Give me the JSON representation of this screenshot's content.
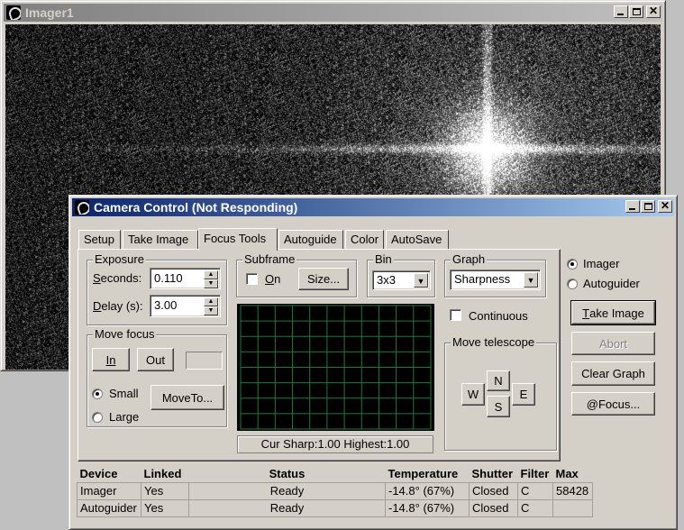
{
  "imager_window": {
    "title": "Imager1"
  },
  "camera_window": {
    "title": "Camera Control (Not Responding)"
  },
  "title_buttons": {
    "minimize_icon": "minimize-icon",
    "maximize_icon": "maximize-icon",
    "close_glyph": "✕"
  },
  "tabs": [
    {
      "label": "Setup",
      "selected": false
    },
    {
      "label": "Take Image",
      "selected": false
    },
    {
      "label": "Focus Tools",
      "selected": true
    },
    {
      "label": "Autoguide",
      "selected": false
    },
    {
      "label": "Color",
      "selected": false
    },
    {
      "label": "AutoSave",
      "selected": false
    }
  ],
  "exposure": {
    "legend": "Exposure",
    "seconds_label_u": "S",
    "seconds_label_rest": "econds:",
    "seconds_value": "0.110",
    "delay_label_u": "D",
    "delay_label_rest": "elay (s):",
    "delay_value": "3.00"
  },
  "subframe": {
    "legend": "Subframe",
    "on_label_u": "O",
    "on_label_rest": "n",
    "on_checked": false,
    "size_label": "Size..."
  },
  "bin": {
    "legend": "Bin",
    "selected": "3x3"
  },
  "graph": {
    "legend": "Graph",
    "selected": "Sharpness"
  },
  "camera_select": {
    "imager_label": "Imager",
    "autoguider_label": "Autoguider",
    "selected": "Imager"
  },
  "continuous": {
    "label": "Continuous",
    "checked": false
  },
  "buttons": {
    "take_image_u": "T",
    "take_image_rest": "ake Image",
    "abort": "Abort",
    "clear_graph": "Clear Graph",
    "at_focus": "@Focus..."
  },
  "move_focus": {
    "legend": "Move focus",
    "in": "In",
    "out": "Out",
    "small_label": "Small",
    "large_label": "Large",
    "selected": "Small",
    "move_to": "MoveTo...",
    "position_value": ""
  },
  "move_telescope": {
    "legend": "Move telescope",
    "n": "N",
    "s": "S",
    "e": "E",
    "w": "W"
  },
  "sharpness_status": "Cur Sharp:1.00 Highest:1.00",
  "graph_colors": {
    "background": "#000000",
    "grid": "#1f7a3a"
  },
  "status_table": {
    "headers": [
      "Device",
      "Linked",
      "Status",
      "Temperature",
      "Shutter",
      "Filter",
      "Max"
    ],
    "rows": [
      [
        "Imager",
        "Yes",
        "Ready",
        "-14.8° (67%)",
        "Closed",
        "C",
        "58428"
      ],
      [
        "Autoguider",
        "Yes",
        "Ready",
        "-14.8° (67%)",
        "Closed",
        "C",
        ""
      ]
    ]
  }
}
